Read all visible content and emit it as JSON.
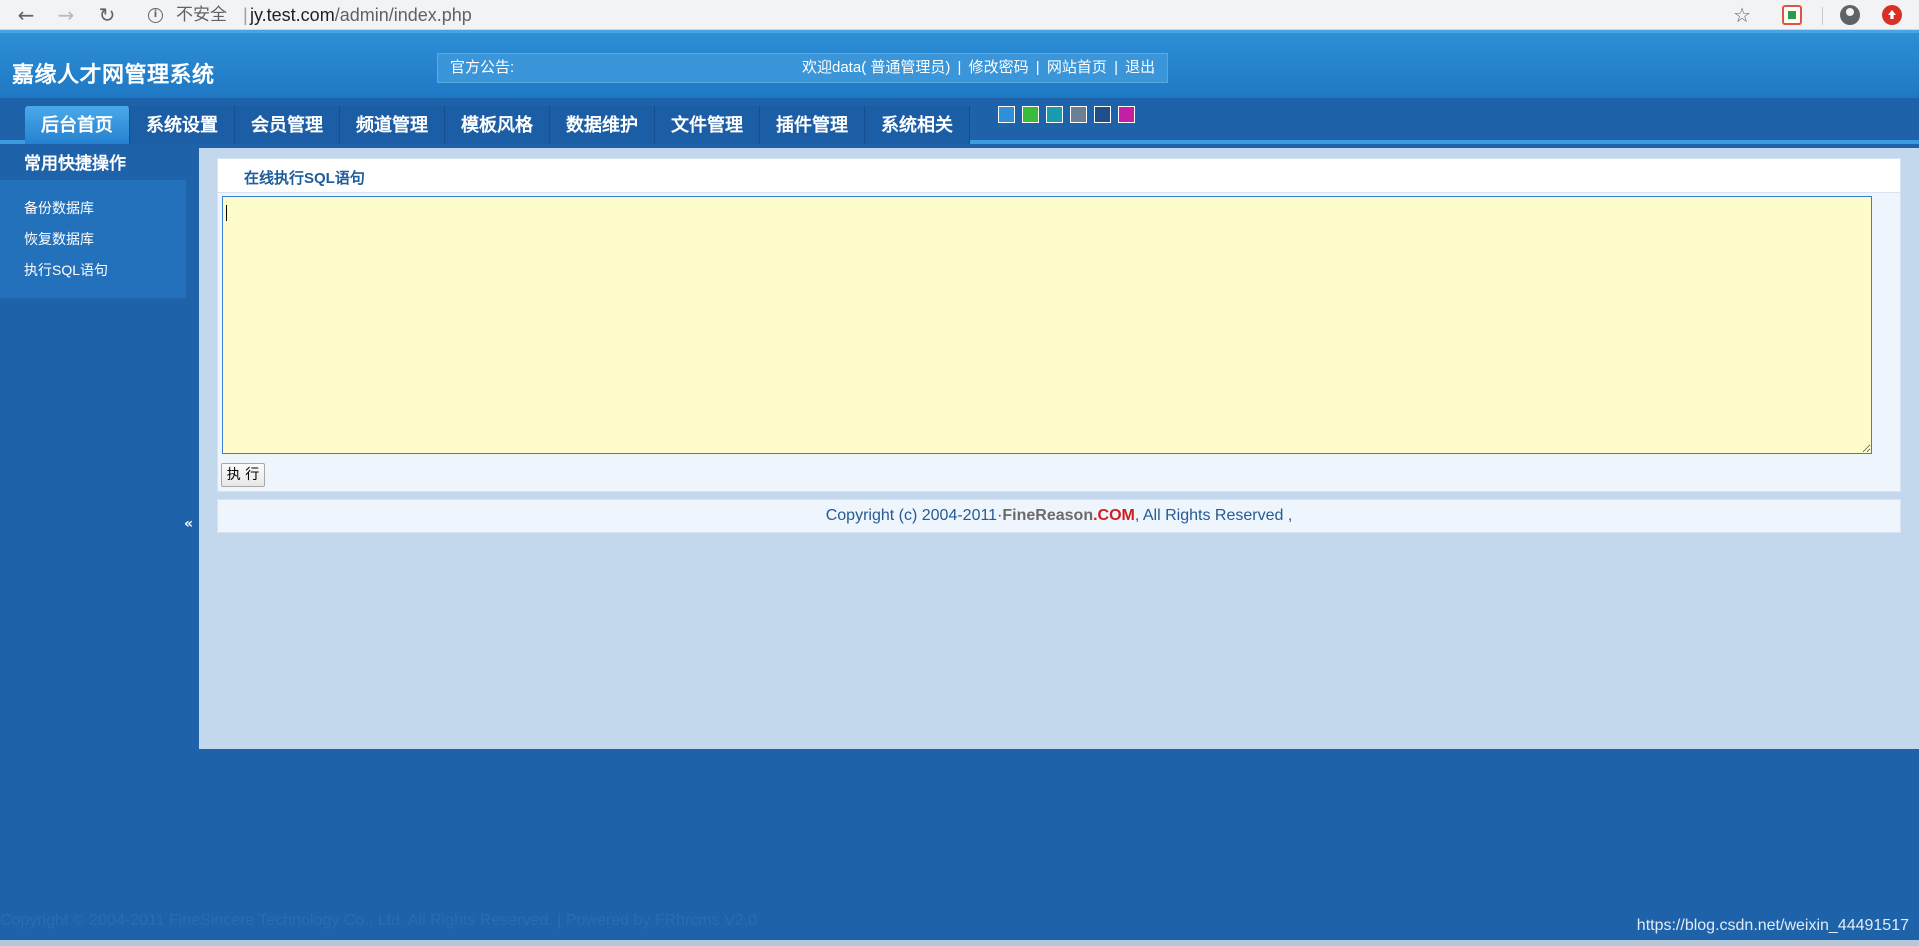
{
  "browser": {
    "security_label": "不安全",
    "url_host": "jy.test.com",
    "url_path": "/admin/index.php",
    "back_icon": "←",
    "forward_icon": "→",
    "reload_icon": "↻",
    "star_icon": "☆"
  },
  "header": {
    "title": "嘉缘人才网管理系统",
    "notice_label": "官方公告:",
    "welcome": "欢迎data( 普通管理员)",
    "change_password": "修改密码",
    "site_home": "网站首页",
    "logout": "退出",
    "separator": "|"
  },
  "nav": {
    "tabs": [
      {
        "label": "后台首页",
        "active": true
      },
      {
        "label": "系统设置"
      },
      {
        "label": "会员管理"
      },
      {
        "label": "频道管理"
      },
      {
        "label": "模板风格"
      },
      {
        "label": "数据维护"
      },
      {
        "label": "文件管理"
      },
      {
        "label": "插件管理"
      },
      {
        "label": "系统相关"
      }
    ],
    "skin_colors": [
      "#2f8fd8",
      "#3bbb3b",
      "#1a9cb0",
      "#6b7f95",
      "#1e4f8a",
      "#c41ea5"
    ]
  },
  "sidebar": {
    "title": "常用快捷操作",
    "items": [
      {
        "label": "备份数据库"
      },
      {
        "label": "恢复数据库"
      },
      {
        "label": "执行SQL语句"
      }
    ],
    "collapse_icon": "«"
  },
  "panel": {
    "title": "在线执行SQL语句",
    "sql_value": "",
    "execute_label": "执 行"
  },
  "footer": {
    "prefix": "Copyright (c) 2004-2011·",
    "brand": "FineReason",
    "com": ".COM",
    "suffix": ", All Rights Reserved ,"
  },
  "bottom": {
    "copyright": "Copyright © 2004-2011 FineSincere Technology Co., Ltd. All Rights Reserved. | Powered by FRhrcms V2.0",
    "watermark": "https://blog.csdn.net/weixin_44491517"
  },
  "colors": {
    "background": "#1e62a9",
    "header": "#2d8fd5",
    "content": "#c3d8ec",
    "textarea": "#fffccb",
    "accent_red": "#cc1f1f"
  }
}
